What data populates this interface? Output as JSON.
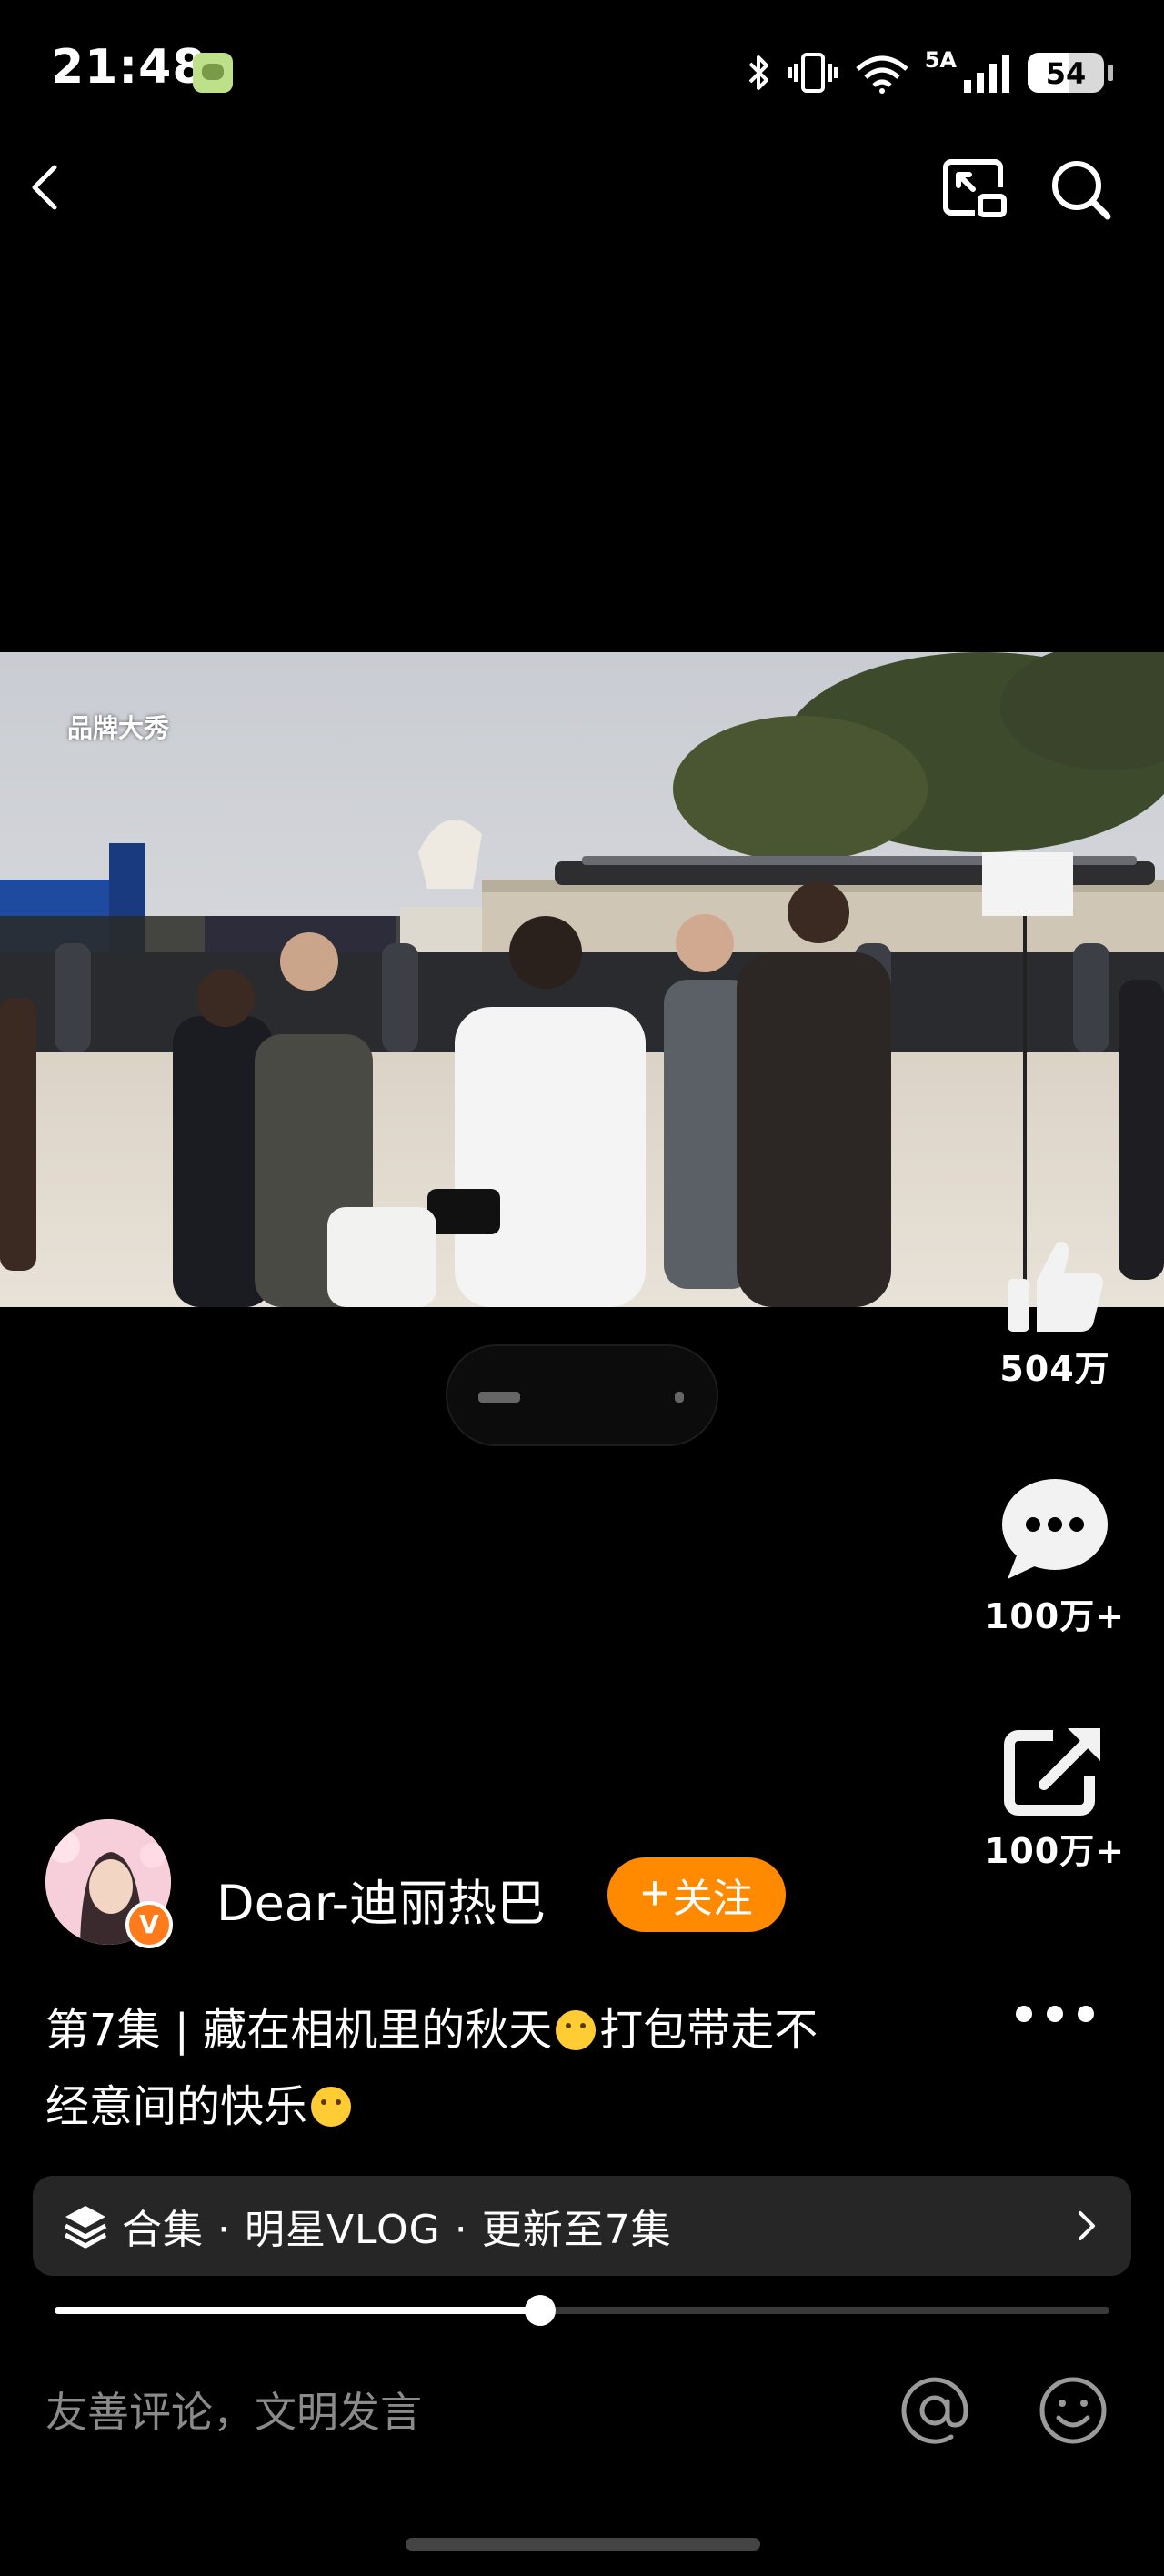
{
  "status_bar": {
    "time": "21:48",
    "network": "5A",
    "battery": "54",
    "battery_level_percent": 54
  },
  "top_nav": {
    "back_icon": "chevron-left-icon",
    "cast_icon": "screen-cast-icon",
    "search_icon": "search-icon"
  },
  "video": {
    "watermark": "品牌大秀",
    "progress_fraction": 0.46
  },
  "actions": {
    "like_count": "504万",
    "comment_count": "100万+",
    "share_count": "100万+"
  },
  "author": {
    "name": "Dear-迪丽热巴",
    "follow_label": "关注",
    "verified_badge": "V"
  },
  "caption": {
    "line1": "第7集 | 藏在相机里的秋天",
    "line1_tail": "打包带走不",
    "line2": "经意间的快乐"
  },
  "collection": {
    "label": "合集 · 明星VLOG · 更新至7集"
  },
  "comment": {
    "placeholder": "友善评论，文明发言"
  },
  "colors": {
    "accent": "#ff8a00",
    "background": "#000000",
    "collection_bg": "#262626"
  }
}
